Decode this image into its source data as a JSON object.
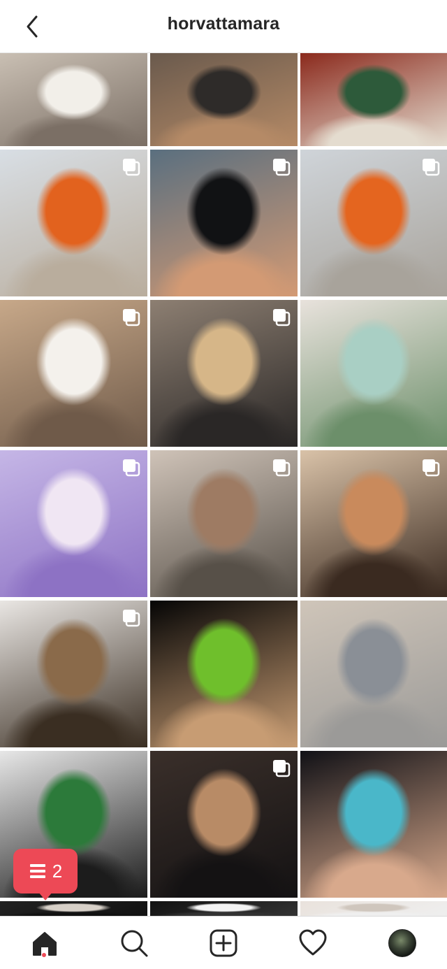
{
  "header": {
    "title": "horvattamara",
    "back_icon": "chevron-left-icon"
  },
  "grid": {
    "posts": [
      {
        "id": "post-1",
        "multi": false,
        "colors": [
          "#c9bfb3",
          "#f2efe9",
          "#7b6f65"
        ]
      },
      {
        "id": "post-2",
        "multi": false,
        "colors": [
          "#6a5a4d",
          "#2e2b29",
          "#b58a66"
        ]
      },
      {
        "id": "post-3",
        "multi": false,
        "colors": [
          "#8b2a1d",
          "#2d5a3a",
          "#e4dccf"
        ]
      },
      {
        "id": "post-4",
        "multi": true,
        "colors": [
          "#d8dee4",
          "#e2621e",
          "#b9ad9d"
        ]
      },
      {
        "id": "post-5",
        "multi": true,
        "colors": [
          "#5a6f7f",
          "#111214",
          "#d39a74"
        ]
      },
      {
        "id": "post-6",
        "multi": true,
        "colors": [
          "#cfd4d9",
          "#e4651f",
          "#a8a39b"
        ]
      },
      {
        "id": "post-7",
        "multi": true,
        "colors": [
          "#c7a889",
          "#f4f1ec",
          "#6f5a49"
        ]
      },
      {
        "id": "post-8",
        "multi": true,
        "colors": [
          "#8d7f72",
          "#d6b688",
          "#2a2726"
        ]
      },
      {
        "id": "post-9",
        "multi": false,
        "colors": [
          "#e8e2dc",
          "#a9cfc4",
          "#6c8f6a"
        ]
      },
      {
        "id": "post-10",
        "multi": true,
        "colors": [
          "#c5b6e6",
          "#f0e6f3",
          "#8d72c4"
        ]
      },
      {
        "id": "post-11",
        "multi": true,
        "colors": [
          "#cfc3b8",
          "#9e7b63",
          "#575048"
        ]
      },
      {
        "id": "post-12",
        "multi": true,
        "colors": [
          "#d9c2a8",
          "#c98a5c",
          "#3a2a20"
        ]
      },
      {
        "id": "post-13",
        "multi": true,
        "colors": [
          "#e9e6e3",
          "#8a6a4a",
          "#3a2e22"
        ]
      },
      {
        "id": "post-14",
        "multi": false,
        "colors": [
          "#050505",
          "#6fbf2c",
          "#c79c73"
        ]
      },
      {
        "id": "post-15",
        "multi": false,
        "colors": [
          "#cfc5b9",
          "#8a8f96",
          "#9b9a98"
        ]
      },
      {
        "id": "post-16",
        "multi": false,
        "colors": [
          "#e7e7e7",
          "#2c7a3a",
          "#1c1c1c"
        ]
      },
      {
        "id": "post-17",
        "multi": true,
        "colors": [
          "#3a2f2a",
          "#b88b66",
          "#141213"
        ]
      },
      {
        "id": "post-18",
        "multi": false,
        "colors": [
          "#111116",
          "#4ab7c9",
          "#d8a98c"
        ]
      },
      {
        "id": "post-19",
        "multi": false,
        "colors": [
          "#222222",
          "#d7d0c8",
          "#111111"
        ]
      },
      {
        "id": "post-20",
        "multi": false,
        "colors": [
          "#121212",
          "#f4f4f4",
          "#333333"
        ]
      },
      {
        "id": "post-21",
        "multi": false,
        "colors": [
          "#e9e2dc",
          "#cfc6bd",
          "#efefef"
        ]
      }
    ]
  },
  "notification": {
    "count": "2",
    "icon": "inbox-stack-icon",
    "color": "#ed4956"
  },
  "bottom_nav": {
    "items": [
      {
        "id": "home",
        "icon": "home-icon",
        "active": true
      },
      {
        "id": "search",
        "icon": "search-icon"
      },
      {
        "id": "new-post",
        "icon": "add-square-icon"
      },
      {
        "id": "activity",
        "icon": "heart-icon"
      },
      {
        "id": "profile",
        "icon": "profile-avatar"
      }
    ]
  }
}
